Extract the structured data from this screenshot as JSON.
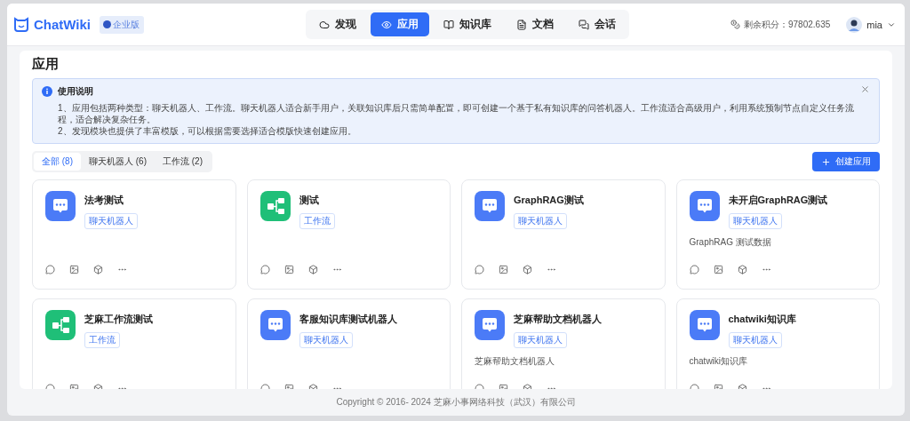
{
  "header": {
    "logo": "ChatWiki",
    "edition": "企业版",
    "nav": [
      {
        "label": "发现",
        "selected": false
      },
      {
        "label": "应用",
        "selected": true
      },
      {
        "label": "知识库",
        "selected": false
      },
      {
        "label": "文档",
        "selected": false
      },
      {
        "label": "会话",
        "selected": false
      }
    ],
    "credits": "剩余积分：97802.635",
    "user": "mia"
  },
  "page_title": "应用",
  "notice": {
    "title": "使用说明",
    "lines": [
      "1、应用包括两种类型：聊天机器人、工作流。聊天机器人适合新手用户，关联知识库后只需简单配置，即可创建一个基于私有知识库的问答机器人。工作流适合高级用户，利用系统预制节点自定义任务流程，适合解决复杂任务。",
      "2、发现模块也提供了丰富模版，可以根据需要选择适合模版快速创建应用。"
    ]
  },
  "filters": [
    {
      "label": "全部 (8)",
      "selected": true
    },
    {
      "label": "聊天机器人 (6)",
      "selected": false
    },
    {
      "label": "工作流 (2)",
      "selected": false
    }
  ],
  "create_button": "创建应用",
  "apps": [
    {
      "name": "法考测试",
      "kind": "chatbot",
      "tag": "聊天机器人"
    },
    {
      "name": "测试",
      "kind": "workflow",
      "tag": "工作流"
    },
    {
      "name": "GraphRAG测试",
      "kind": "chatbot",
      "tag": "聊天机器人"
    },
    {
      "name": "未开启GraphRAG测试",
      "kind": "chatbot",
      "tag": "聊天机器人",
      "description": "GraphRAG 测试数据"
    },
    {
      "name": "芝麻工作流测试",
      "kind": "workflow",
      "tag": "工作流"
    },
    {
      "name": "客服知识库测试机器人",
      "kind": "chatbot",
      "tag": "聊天机器人"
    },
    {
      "name": "芝麻帮助文档机器人",
      "kind": "chatbot",
      "tag": "聊天机器人",
      "description": "芝麻帮助文档机器人"
    },
    {
      "name": "chatwiki知识库",
      "kind": "chatbot",
      "tag": "聊天机器人",
      "description": "chatwiki知识库"
    }
  ],
  "footer": "Copyright © 2016- 2024 芝麻小事网络科技（武汉）有限公司"
}
